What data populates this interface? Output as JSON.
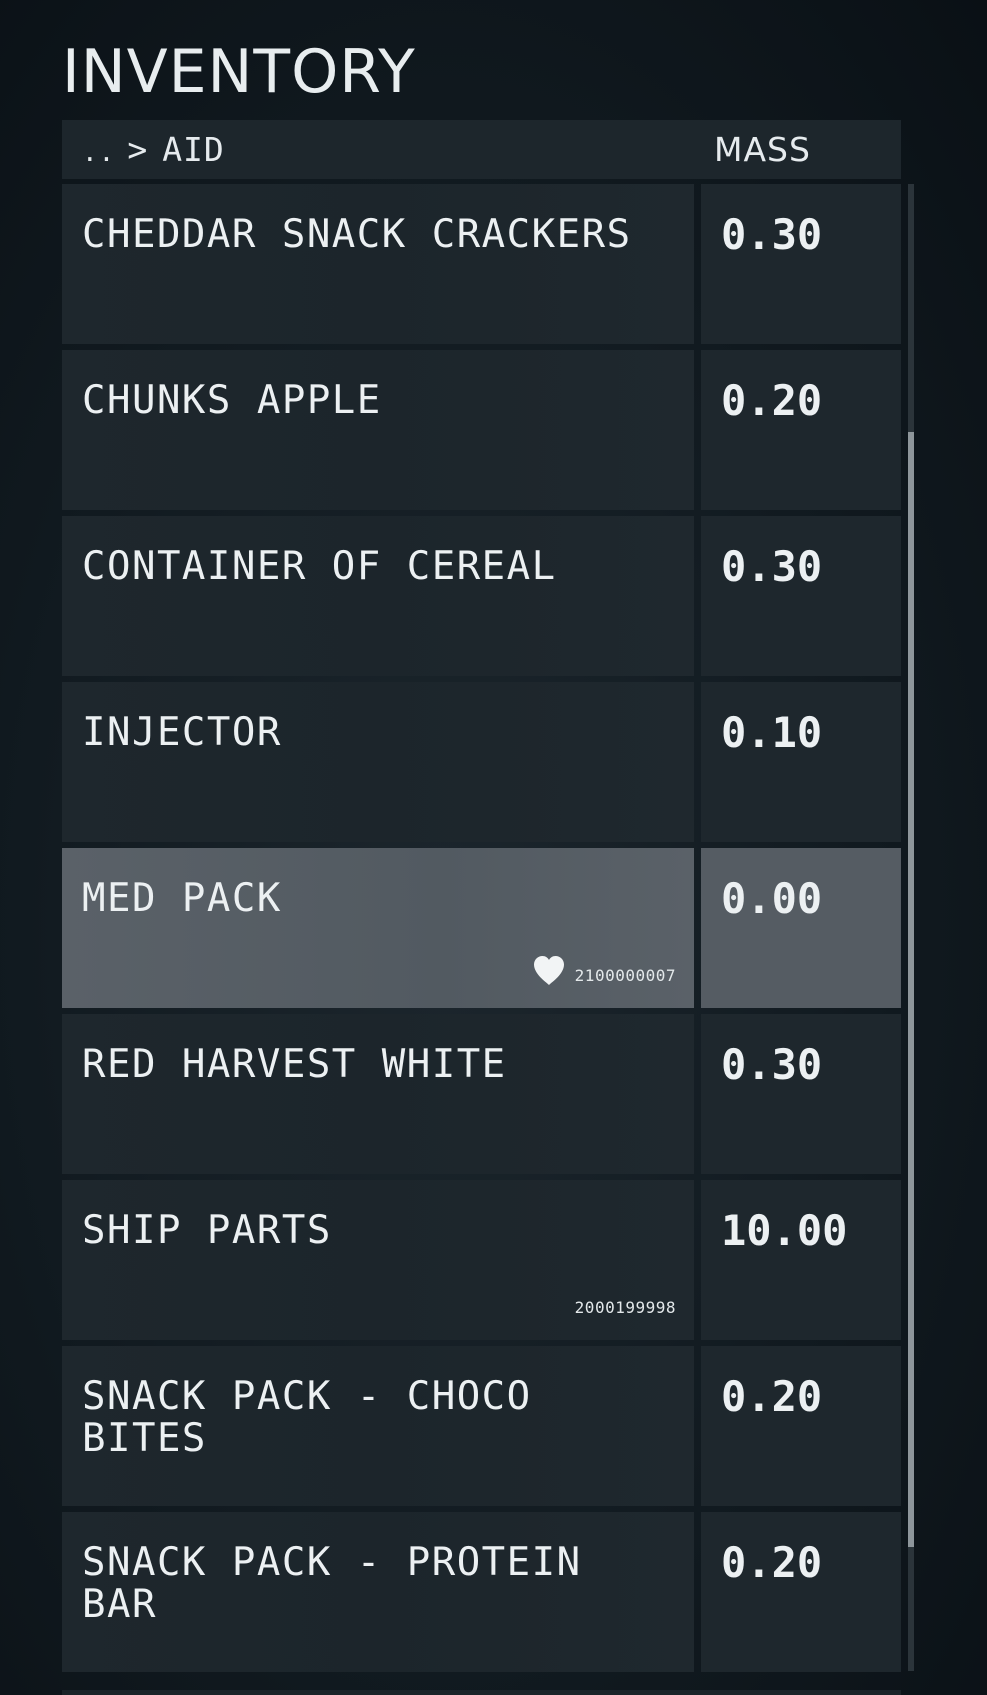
{
  "title": "INVENTORY",
  "header": {
    "crumb_dots": "..",
    "crumb_separator": ">",
    "category": "AID",
    "mass_label": "MASS"
  },
  "items": [
    {
      "name": "CHEDDAR SNACK CRACKERS",
      "mass": "0.30",
      "code": "",
      "favorite": false,
      "selected": false
    },
    {
      "name": "CHUNKS APPLE",
      "mass": "0.20",
      "code": "",
      "favorite": false,
      "selected": false
    },
    {
      "name": "CONTAINER OF CEREAL",
      "mass": "0.30",
      "code": "",
      "favorite": false,
      "selected": false
    },
    {
      "name": "INJECTOR",
      "mass": "0.10",
      "code": "",
      "favorite": false,
      "selected": false
    },
    {
      "name": "MED PACK",
      "mass": "0.00",
      "code": "2100000007",
      "favorite": true,
      "selected": true
    },
    {
      "name": "RED HARVEST WHITE",
      "mass": "0.30",
      "code": "",
      "favorite": false,
      "selected": false
    },
    {
      "name": "SHIP PARTS",
      "mass": "10.00",
      "code": "2000199998",
      "favorite": false,
      "selected": false
    },
    {
      "name": "SNACK PACK - CHOCO BITES",
      "mass": "0.20",
      "code": "",
      "favorite": false,
      "selected": false
    },
    {
      "name": "SNACK PACK - PROTEIN BAR",
      "mass": "0.20",
      "code": "",
      "favorite": false,
      "selected": false
    }
  ],
  "icons": {
    "favorite": "heart-icon"
  },
  "colors": {
    "selected_row": "#555c63",
    "row": "#1e272d",
    "scroll_thumb": "#8e969b"
  }
}
